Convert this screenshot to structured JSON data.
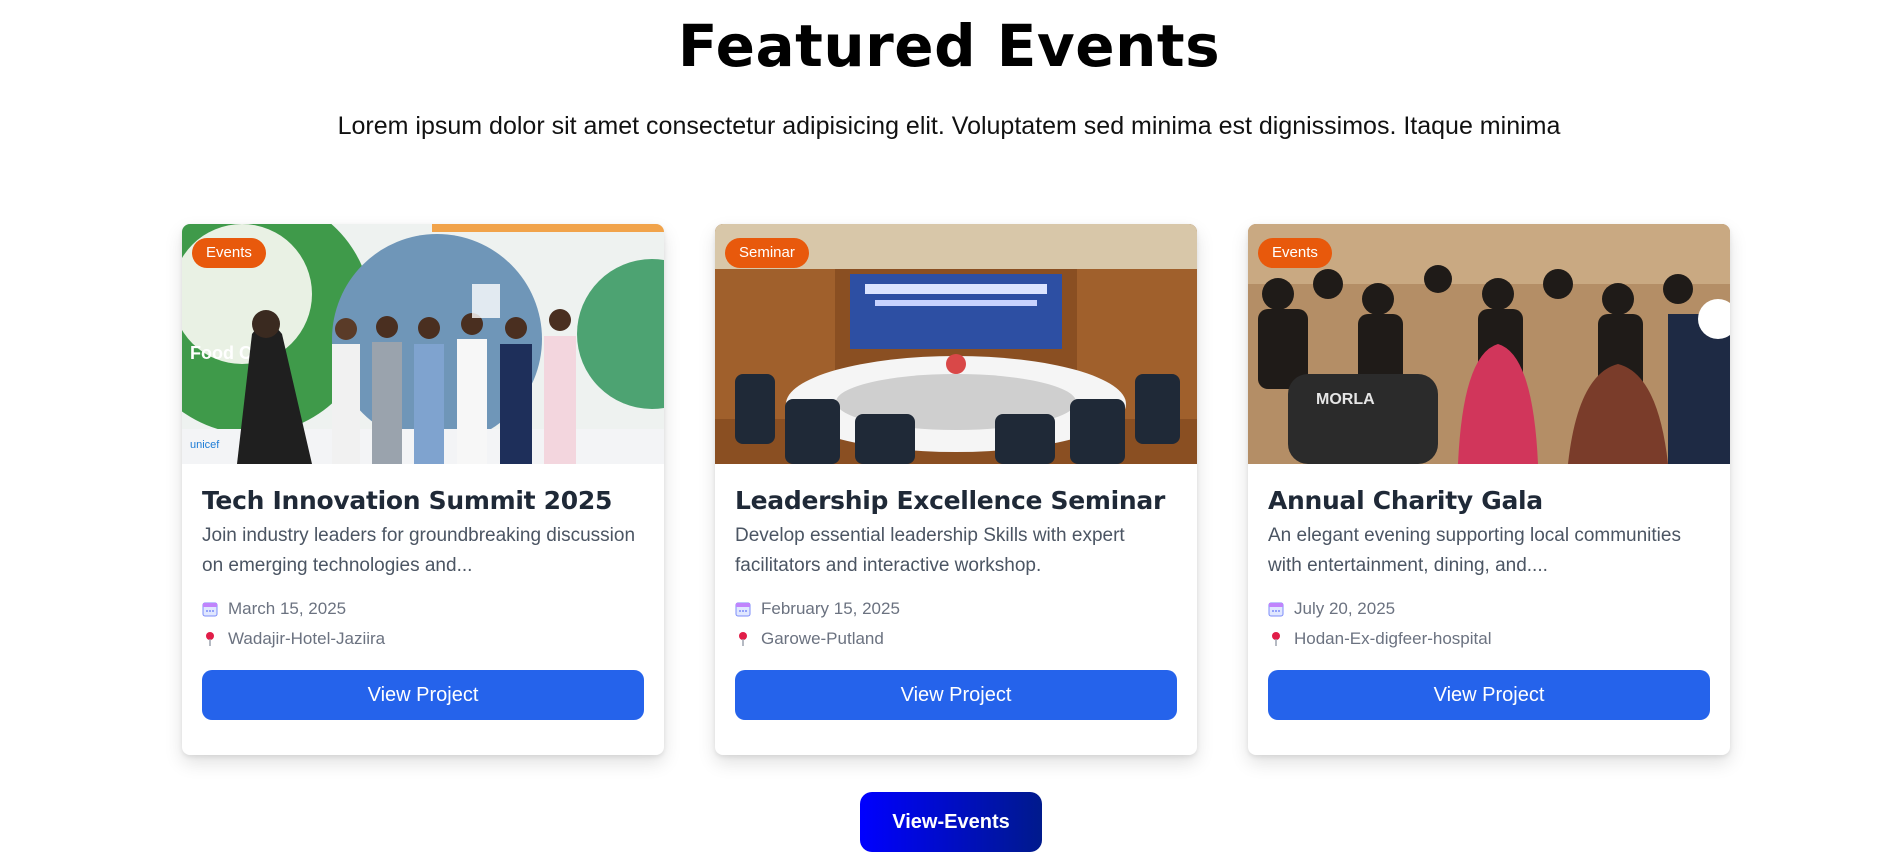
{
  "header": {
    "title": "Featured Events",
    "subtitle": "Lorem ipsum dolor sit amet consectetur adipisicing elit. Voluptatem sed minima est dignissimos. Itaque minima"
  },
  "cards": [
    {
      "badge": "Events",
      "title": "Tech Innovation Summit 2025",
      "description": "Join industry leaders for groundbreaking discussion on emerging technologies and...",
      "date": "March 15, 2025",
      "location": "Wadajir-Hotel-Jaziira",
      "button": "View Project",
      "image_text": "Food Clim",
      "image_logo": "unicef"
    },
    {
      "badge": "Seminar",
      "title": "Leadership Excellence Seminar",
      "description": "Develop essential leadership Skills with expert facilitators and interactive workshop.",
      "date": "February 15, 2025",
      "location": "Garowe-Putland",
      "button": "View Project"
    },
    {
      "badge": "Events",
      "title": "Annual Charity Gala",
      "description": "An elegant evening supporting local communities with entertainment, dining, and....",
      "date": "July 20, 2025",
      "location": "Hodan-Ex-digfeer-hospital",
      "button": "View Project",
      "image_text": "MORLA"
    }
  ],
  "footer": {
    "button": "View-Events"
  },
  "icons": {
    "date": "calendar-icon",
    "location": "pin-icon"
  },
  "colors": {
    "badge": "#e8590c",
    "card_button": "#2563eb",
    "events_button": "#0000ff"
  }
}
